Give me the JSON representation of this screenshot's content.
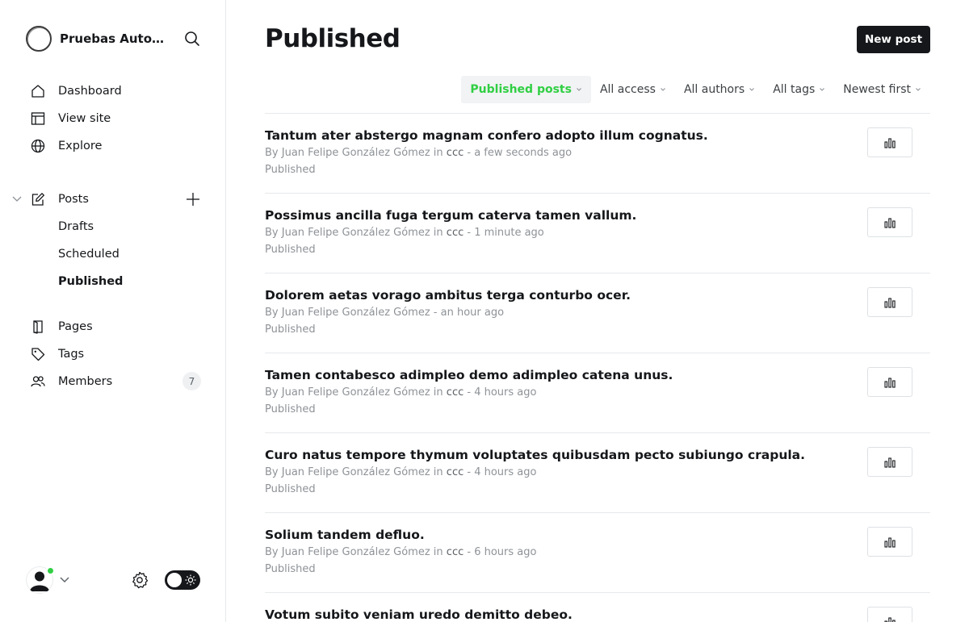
{
  "site": {
    "title": "Pruebas Automa..."
  },
  "sidebar": {
    "nav": [
      {
        "label": "Dashboard",
        "icon": "home-icon"
      },
      {
        "label": "View site",
        "icon": "layout-icon"
      },
      {
        "label": "Explore",
        "icon": "globe-icon"
      }
    ],
    "posts": {
      "label": "Posts",
      "icon": "edit-icon"
    },
    "post_sub": [
      {
        "label": "Drafts",
        "active": false
      },
      {
        "label": "Scheduled",
        "active": false
      },
      {
        "label": "Published",
        "active": true
      }
    ],
    "secondary": [
      {
        "label": "Pages",
        "icon": "page-icon"
      },
      {
        "label": "Tags",
        "icon": "tag-icon"
      },
      {
        "label": "Members",
        "icon": "members-icon",
        "badge": "7"
      }
    ]
  },
  "main": {
    "title": "Published",
    "new_post_label": "New post",
    "filters": [
      {
        "label": "Published posts",
        "active": true
      },
      {
        "label": "All access",
        "active": false
      },
      {
        "label": "All authors",
        "active": false
      },
      {
        "label": "All tags",
        "active": false
      },
      {
        "label": "Newest first",
        "active": false
      }
    ],
    "posts": [
      {
        "title": "Tantum ater abstergo magnam confero adopto illum cognatus.",
        "author": "By Juan Felipe González Gómez",
        "in": " in ",
        "tag": "ccc",
        "time": " - a few seconds ago",
        "status": "Published"
      },
      {
        "title": "Possimus ancilla fuga tergum caterva tamen vallum.",
        "author": "By Juan Felipe González Gómez",
        "in": " in ",
        "tag": "ccc",
        "time": " - 1 minute ago",
        "status": "Published"
      },
      {
        "title": "Dolorem aetas vorago ambitus terga conturbo ocer.",
        "author": "By Juan Felipe González Gómez",
        "in": "",
        "tag": "",
        "time": " - an hour ago",
        "status": "Published"
      },
      {
        "title": "Tamen contabesco adimpleo demo adimpleo catena unus.",
        "author": "By Juan Felipe González Gómez",
        "in": " in ",
        "tag": "ccc",
        "time": " - 4 hours ago",
        "status": "Published"
      },
      {
        "title": "Curo natus tempore thymum voluptates quibusdam pecto subiungo crapula.",
        "author": "By Juan Felipe González Gómez",
        "in": " in ",
        "tag": "ccc",
        "time": " - 4 hours ago",
        "status": "Published"
      },
      {
        "title": "Solium tandem defluo.",
        "author": "By Juan Felipe González Gómez",
        "in": " in ",
        "tag": "ccc",
        "time": " - 6 hours ago",
        "status": "Published"
      },
      {
        "title": "Votum subito veniam uredo demitto debeo.",
        "author": "",
        "in": "",
        "tag": "",
        "time": "",
        "status": ""
      }
    ]
  },
  "colors": {
    "accent": "#30cf43",
    "text": "#15171a",
    "muted": "#8e9297",
    "border": "#e6e9eb"
  }
}
